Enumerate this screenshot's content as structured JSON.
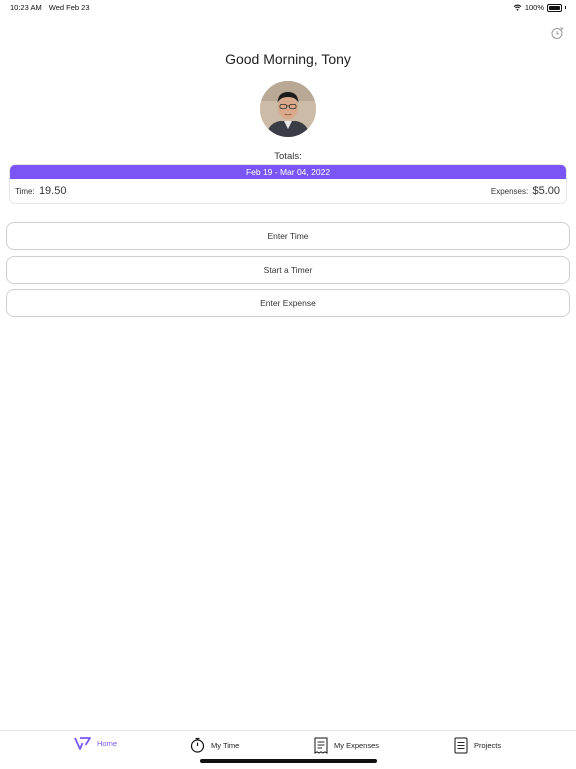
{
  "status": {
    "time": "10:23 AM",
    "date": "Wed Feb 23",
    "battery": "100%"
  },
  "greeting": "Good Morning, Tony",
  "totals": {
    "label": "Totals:",
    "range": "Feb 19 - Mar 04, 2022",
    "time_label": "Time:",
    "time_value": "19.50",
    "expenses_label": "Expenses:",
    "expenses_value": "$5.00"
  },
  "actions": [
    "Enter Time",
    "Start a Timer",
    "Enter Expense"
  ],
  "tabs": [
    {
      "label": "Home",
      "icon": "home-logo-icon",
      "active": true
    },
    {
      "label": "My Time",
      "icon": "stopwatch-icon"
    },
    {
      "label": "My Expenses",
      "icon": "receipt-icon"
    },
    {
      "label": "Projects",
      "icon": "document-icon"
    }
  ],
  "colors": {
    "accent": "#7a56f4"
  }
}
